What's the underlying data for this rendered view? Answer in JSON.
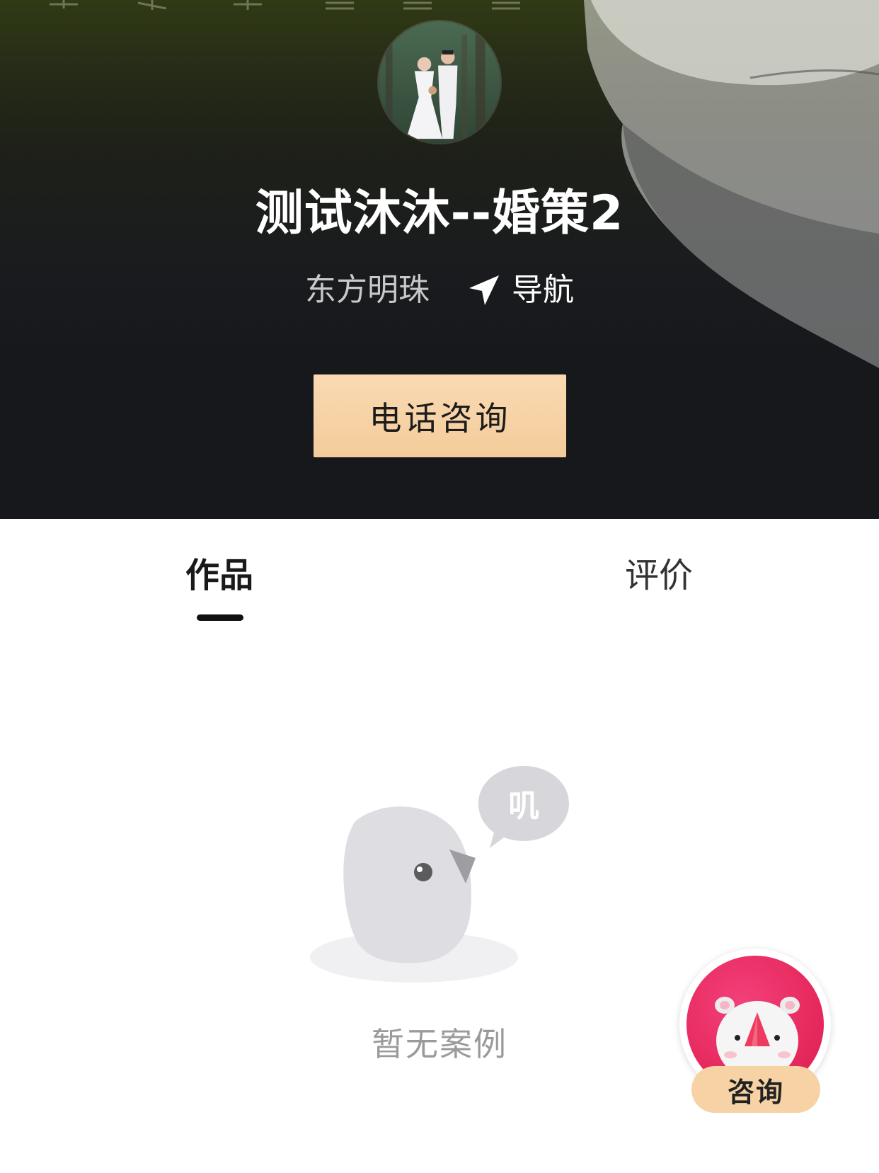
{
  "header": {
    "shop_name": "测试沐沐--婚策2",
    "location": "东方明珠",
    "nav_label": "导航",
    "call_button_label": "电话咨询"
  },
  "tabs": [
    {
      "label": "作品",
      "active": true
    },
    {
      "label": "评价",
      "active": false
    }
  ],
  "empty_state": {
    "bubble_text": "叽",
    "message": "暂无案例"
  },
  "consult_fab": {
    "label": "咨询"
  },
  "colors": {
    "hero_background": "#17181c",
    "call_button": "#f4cc9a",
    "fab_accent": "#e72a5e",
    "fab_label_bg": "#f6d2a4",
    "empty_text": "#9a9a9a"
  }
}
